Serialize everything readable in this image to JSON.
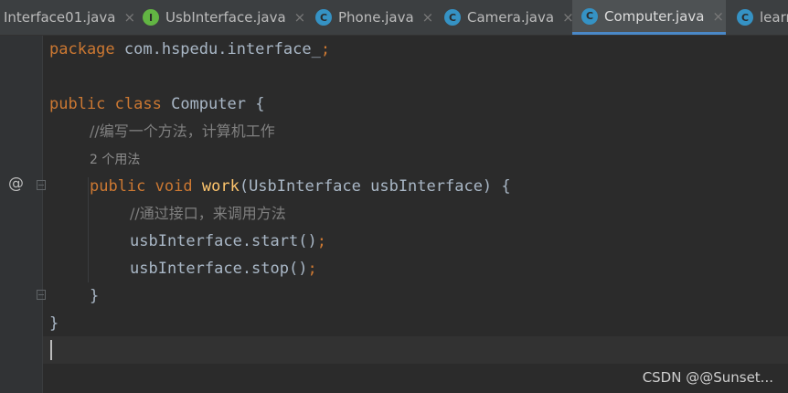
{
  "tabs": [
    {
      "label": "Interface01.java",
      "icon": "none",
      "close": "×",
      "active": false
    },
    {
      "label": "UsbInterface.java",
      "icon": "interface-icon",
      "close": "×",
      "active": false
    },
    {
      "label": "Phone.java",
      "icon": "class-icon",
      "close": "×",
      "active": false
    },
    {
      "label": "Camera.java",
      "icon": "class-icon",
      "close": "×",
      "active": false
    },
    {
      "label": "Computer.java",
      "icon": "class-icon",
      "close": "×",
      "active": true
    },
    {
      "label": "learn",
      "icon": "class-icon",
      "close": "",
      "active": false
    }
  ],
  "icons": {
    "interface_glyph": "I",
    "class_glyph": "C",
    "override_marker": "@"
  },
  "code": {
    "line1_kw": "package",
    "line1_rest": " com.hspedu.interface_",
    "line1_semi": ";",
    "line3_kw1": "public",
    "line3_kw2": "class",
    "line3_rest": " Computer {",
    "line4_comment": "//编写一个方法，计算机工作",
    "usage_hint": "2 个用法",
    "line6_kw1": "public",
    "line6_kw2": "void",
    "line6_fn": "work",
    "line6_rest": "(UsbInterface usbInterface) {",
    "line7_comment": "//通过接口，来调用方法",
    "line8_call": "usbInterface.start()",
    "line8_semi": ";",
    "line9_call": "usbInterface.stop()",
    "line9_semi": ";",
    "line10_brace": "}",
    "line11_brace": "}"
  },
  "watermark": "CSDN @@Sunset...",
  "colors": {
    "keyword": "#cc7832",
    "function": "#ffc66d",
    "comment": "#808080",
    "text": "#a9b7c6",
    "active_tab_underline": "#4a88c7"
  }
}
